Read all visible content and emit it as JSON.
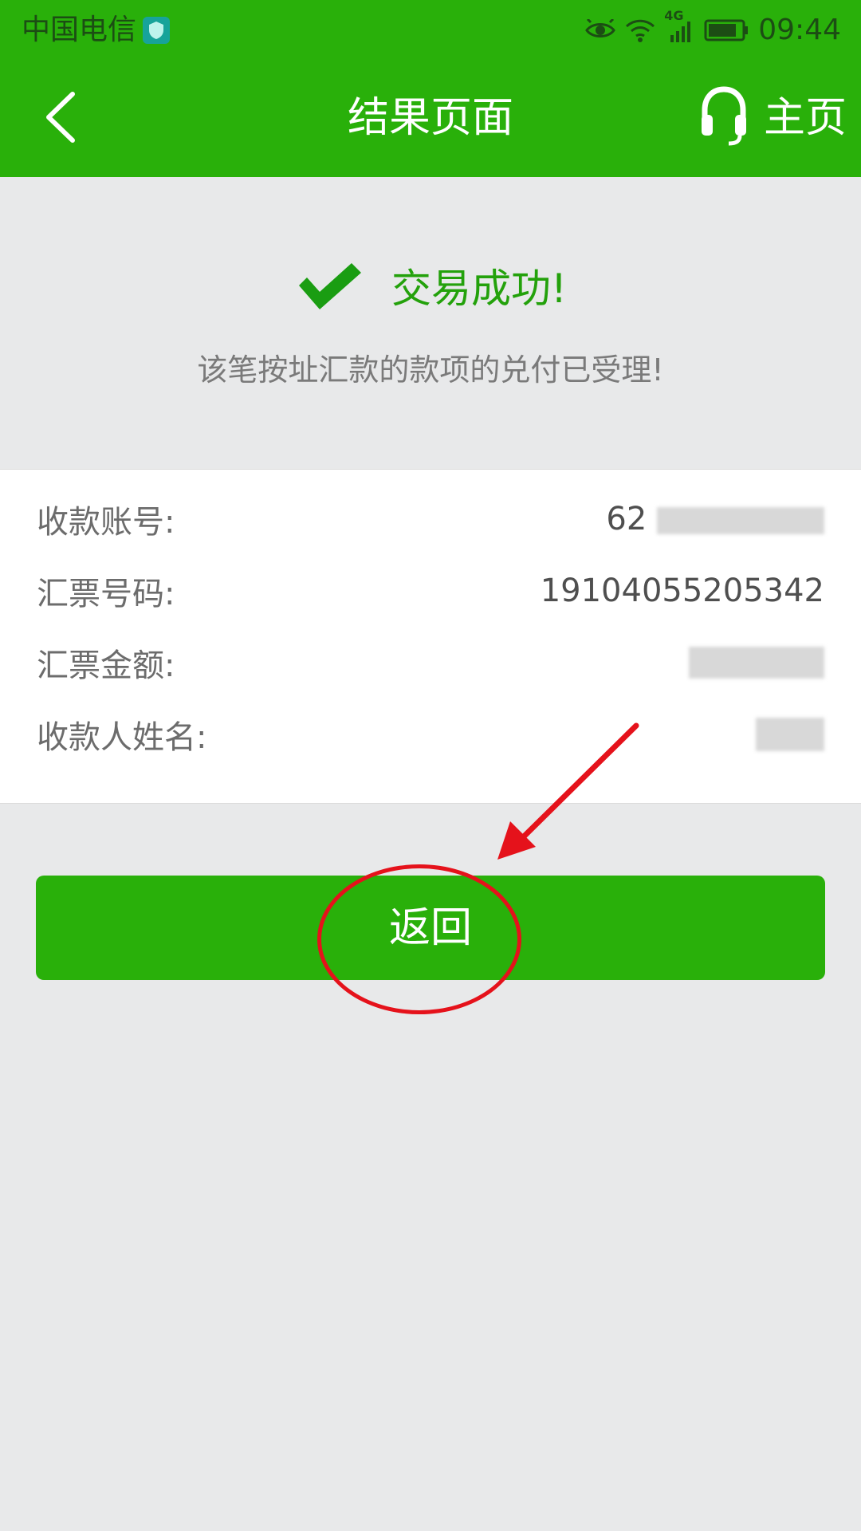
{
  "status_bar": {
    "carrier": "中国电信",
    "network": "4G",
    "time": "09:44"
  },
  "nav": {
    "title": "结果页面",
    "home_label": "主页",
    "icons": {
      "back": "chevron-left-icon",
      "home": "headset-icon"
    }
  },
  "result": {
    "title": "交易成功!",
    "description": "该笔按址汇款的款项的兑付已受理!",
    "icon": "checkmark-icon"
  },
  "details": [
    {
      "label": "收款账号:",
      "value": "62"
    },
    {
      "label": "汇票号码:",
      "value": "19104055205342"
    },
    {
      "label": "汇票金额:",
      "value": ""
    },
    {
      "label": "收款人姓名:",
      "value": ""
    }
  ],
  "actions": {
    "return_label": "返回"
  },
  "colors": {
    "brand_green": "#29b00a",
    "success_green": "#23a10b",
    "annotation_red": "#e5121b",
    "background": "#e8e9ea"
  }
}
